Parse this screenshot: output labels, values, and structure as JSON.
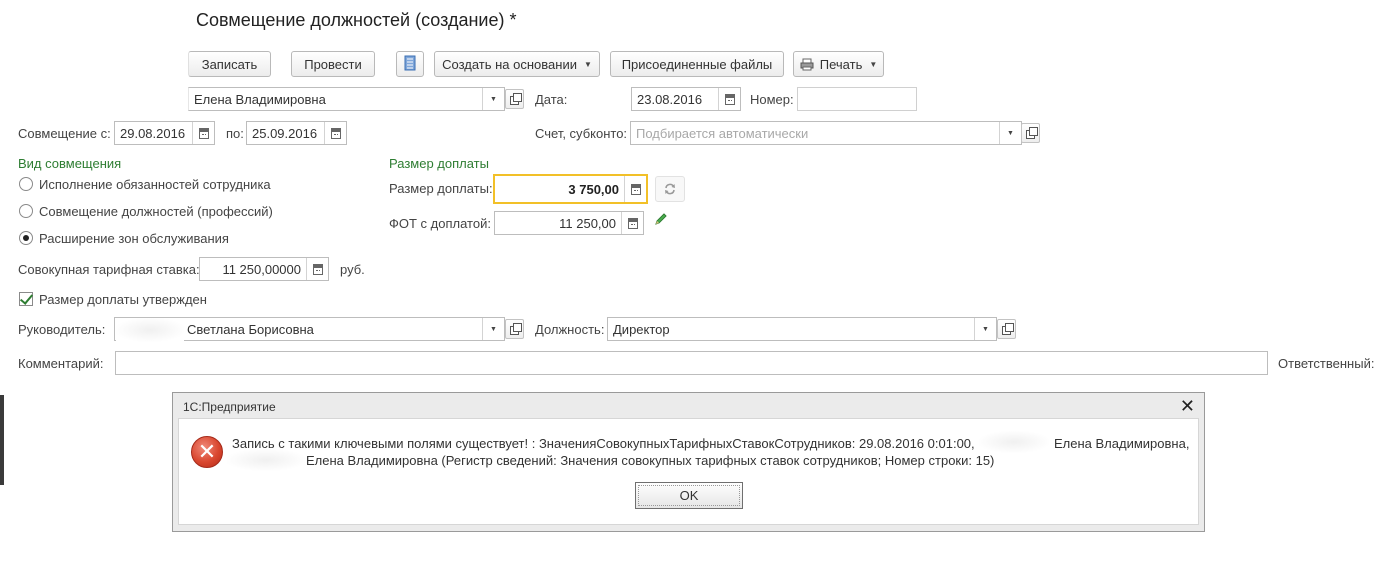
{
  "window": {
    "title": "Совмещение должностей (создание) *"
  },
  "toolbar": {
    "write": "Записать",
    "post": "Провести",
    "create_based": "Создать на основании",
    "attached_files": "Присоединенные файлы",
    "print": "Печать"
  },
  "header": {
    "employee_value": "Елена Владимировна",
    "date_label": "Дата:",
    "date_value": "23.08.2016",
    "number_label": "Номер:",
    "number_value": ""
  },
  "period": {
    "from_label": "Совмещение с:",
    "from_value": "29.08.2016",
    "to_label": "по:",
    "to_value": "25.09.2016",
    "account_label": "Счет, субконто:",
    "account_placeholder": "Подбирается автоматически"
  },
  "kind": {
    "group_label": "Вид совмещения",
    "options": [
      {
        "label": "Исполнение обязанностей сотрудника",
        "selected": false
      },
      {
        "label": "Совмещение должностей (профессий)",
        "selected": false
      },
      {
        "label": "Расширение зон обслуживания",
        "selected": true
      }
    ]
  },
  "surcharge": {
    "group_label": "Размер доплаты",
    "amount_label": "Размер доплаты:",
    "amount_value": "3 750,00",
    "fot_label": "ФОТ с доплатой:",
    "fot_value": "11 250,00"
  },
  "tariff": {
    "label": "Совокупная тарифная ставка:",
    "value": "11 250,00000",
    "unit": "руб."
  },
  "approved": {
    "label": "Размер доплаты утвержден",
    "checked": true
  },
  "manager": {
    "label": "Руководитель:",
    "value": "Светлана Борисовна",
    "position_label": "Должность:",
    "position_value": "Директор"
  },
  "comment": {
    "label": "Комментарий:",
    "value": "",
    "responsible_label": "Ответственный:"
  },
  "dialog": {
    "title": "1С:Предприятие",
    "line1": "Запись с такими ключевыми полями существует! : ЗначенияСовокупныхТарифныхСтавокСотрудников: 29.08.2016 0:01:00,",
    "line1_tail": "Елена Владимировна,",
    "line2": "Елена Владимировна (Регистр сведений: Значения совокупных тарифных ставок сотрудников; Номер строки: 15)",
    "ok": "OK"
  },
  "colors": {
    "accent_green": "#2e7d32",
    "focus_yellow": "#f2c028",
    "error_red": "#d9472f"
  }
}
